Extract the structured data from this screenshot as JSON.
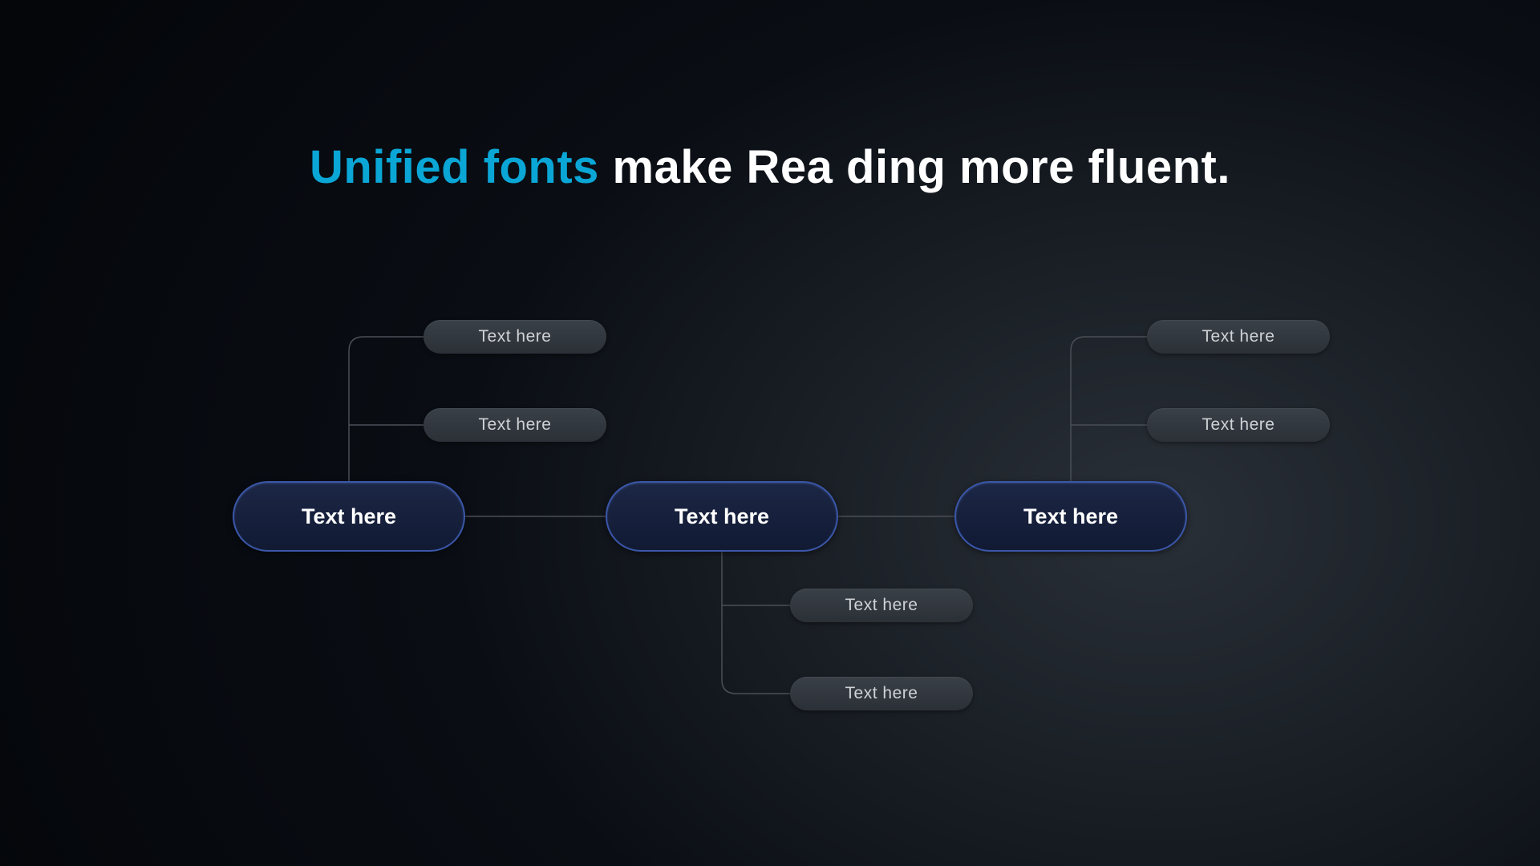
{
  "title": {
    "accent": "Unified fonts",
    "rest": " make Rea ding more fluent."
  },
  "nodes": {
    "main": [
      {
        "label": "Text here"
      },
      {
        "label": "Text here"
      },
      {
        "label": "Text here"
      }
    ],
    "sub_left": [
      {
        "label": "Text here"
      },
      {
        "label": "Text here"
      }
    ],
    "sub_center": [
      {
        "label": "Text here"
      },
      {
        "label": "Text here"
      }
    ],
    "sub_right": [
      {
        "label": "Text here"
      },
      {
        "label": "Text here"
      }
    ]
  },
  "colors": {
    "accent_text": "#0aa6d6",
    "node_border": "#3a56a8",
    "node_bg_top": "#1c2746",
    "node_bg_bot": "#111a33",
    "sub_bg": "#3a4048",
    "connector": "#4a4f57"
  }
}
